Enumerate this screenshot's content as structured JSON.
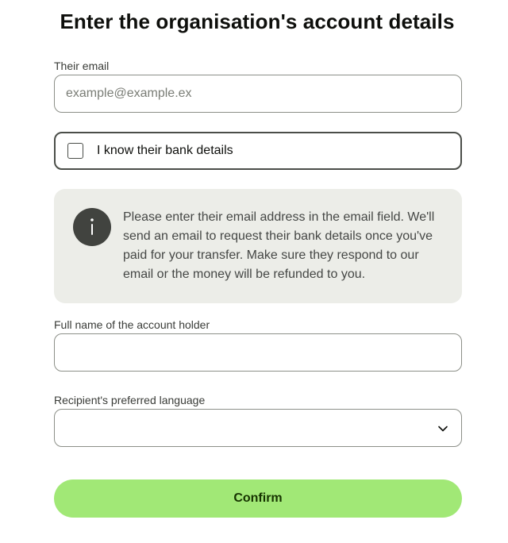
{
  "page": {
    "title": "Enter the organisation's account details"
  },
  "email": {
    "label": "Their email",
    "placeholder": "example@example.ex",
    "value": ""
  },
  "bank_details_checkbox": {
    "label": "I know their bank details",
    "checked": false
  },
  "info": {
    "icon": "info-icon",
    "text": "Please enter their email address in the email field. We'll send an email to request their bank details once you've paid for your transfer. Make sure they respond to our email or the money will be refunded to you."
  },
  "full_name": {
    "label": "Full name of the account holder",
    "value": ""
  },
  "language": {
    "label": "Recipient's preferred language",
    "value": "",
    "icon": "chevron-down-icon"
  },
  "confirm": {
    "label": "Confirm",
    "color": "#a1e876"
  }
}
